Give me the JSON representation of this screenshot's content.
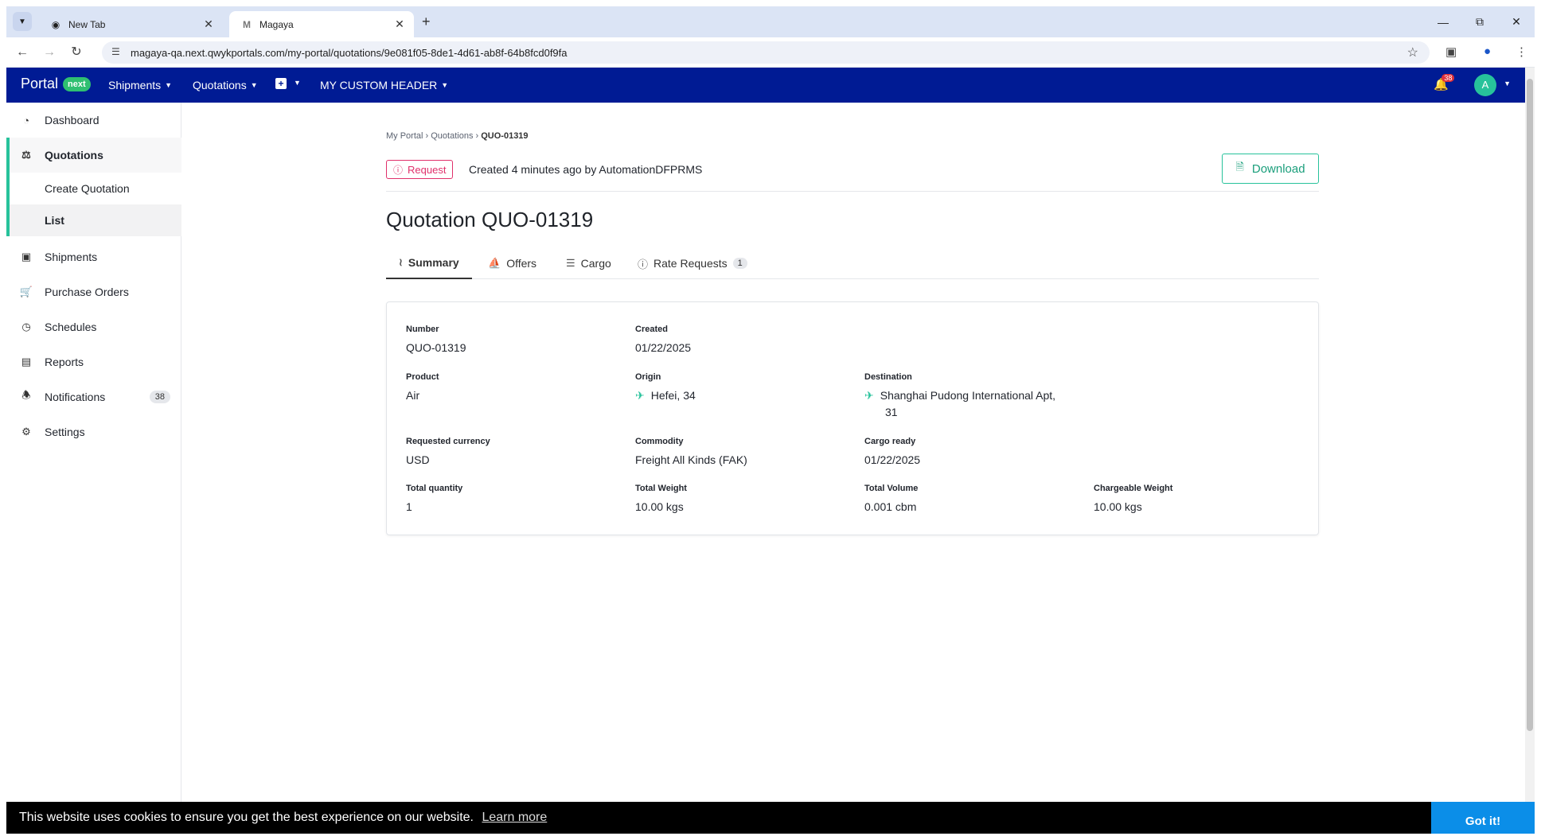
{
  "browser": {
    "tabs": [
      {
        "title": "New Tab"
      },
      {
        "title": "Magaya"
      }
    ],
    "url": "magaya-qa.next.qwykportals.com/my-portal/quotations/9e081f05-8de1-4d61-ab8f-64b8fcd0f9fa"
  },
  "header": {
    "brand": "Portal",
    "brand_badge": "next",
    "nav": [
      "Shipments",
      "Quotations",
      "MY CUSTOM HEADER"
    ],
    "notif_count": "38",
    "avatar_initial": "A"
  },
  "sidebar": {
    "items": [
      {
        "label": "Dashboard",
        "icon": "dashboard-icon"
      },
      {
        "label": "Quotations",
        "icon": "quotations-icon"
      },
      {
        "label": "Shipments",
        "icon": "box-icon"
      },
      {
        "label": "Purchase Orders",
        "icon": "cart-icon"
      },
      {
        "label": "Schedules",
        "icon": "clock-icon"
      },
      {
        "label": "Reports",
        "icon": "bar-chart-icon"
      },
      {
        "label": "Notifications",
        "icon": "bell-icon",
        "badge": "38"
      },
      {
        "label": "Settings",
        "icon": "gear-icon"
      }
    ],
    "sub_items": [
      "Create Quotation",
      "List"
    ]
  },
  "breadcrumb": {
    "a": "My Portal",
    "b": "Quotations",
    "c": "QUO-01319"
  },
  "status": {
    "badge": "Request",
    "created_text": "Created 4 minutes ago by AutomationDFPRMS",
    "download_label": "Download"
  },
  "page_title": "Quotation QUO-01319",
  "tabs": {
    "summary": "Summary",
    "offers": "Offers",
    "cargo": "Cargo",
    "rate_requests": "Rate Requests",
    "rate_requests_count": "1"
  },
  "details": {
    "number": {
      "label": "Number",
      "value": "QUO-01319"
    },
    "created": {
      "label": "Created",
      "value": "01/22/2025"
    },
    "product": {
      "label": "Product",
      "value": "Air"
    },
    "origin": {
      "label": "Origin",
      "value": "Hefei, 34"
    },
    "destination": {
      "label": "Destination",
      "value": "Shanghai Pudong International Apt,",
      "value2": "31"
    },
    "currency": {
      "label": "Requested currency",
      "value": "USD"
    },
    "commodity": {
      "label": "Commodity",
      "value": "Freight All Kinds (FAK)"
    },
    "cargo_ready": {
      "label": "Cargo ready",
      "value": "01/22/2025"
    },
    "total_quantity": {
      "label": "Total quantity",
      "value": "1"
    },
    "total_weight": {
      "label": "Total Weight",
      "value": "10.00 kgs"
    },
    "total_volume": {
      "label": "Total Volume",
      "value": "0.001 cbm"
    },
    "chargeable_weight": {
      "label": "Chargeable Weight",
      "value": "10.00 kgs"
    }
  },
  "cookie": {
    "message": "This website uses cookies to ensure you get the best experience on our website.",
    "learn_more": "Learn more",
    "button": "Got it!"
  },
  "colors": {
    "header": "#001b94",
    "accent": "#27c29b",
    "request": "#e0306b",
    "cookie_button": "#0b8ee8"
  }
}
